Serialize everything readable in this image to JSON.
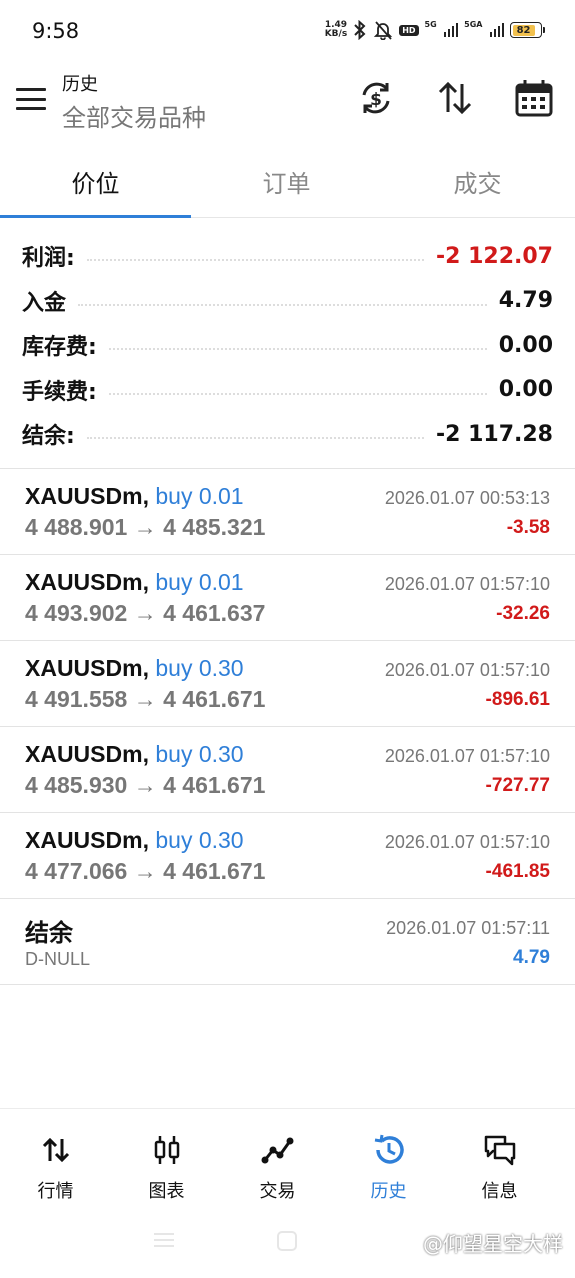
{
  "status_bar": {
    "time": "9:58",
    "net_speed_value": "1.49",
    "net_speed_unit": "KB/s",
    "hd_label": "HD",
    "sim1_label": "5G",
    "sim2_label": "5GA",
    "battery": "82",
    "battery_color": "#f2c14e"
  },
  "header": {
    "title": "历史",
    "subtitle": "全部交易品种",
    "icons": [
      "menu-icon",
      "currency-exchange-icon",
      "sort-icon",
      "calendar-icon"
    ]
  },
  "tabs": [
    {
      "label": "价位",
      "active": true
    },
    {
      "label": "订单",
      "active": false
    },
    {
      "label": "成交",
      "active": false
    }
  ],
  "summary": [
    {
      "label": "利润:",
      "value": "-2 122.07",
      "negative": true
    },
    {
      "label": "入金",
      "value": "4.79",
      "negative": false
    },
    {
      "label": "库存费:",
      "value": "0.00",
      "negative": false
    },
    {
      "label": "手续费:",
      "value": "0.00",
      "negative": false
    },
    {
      "label": "结余:",
      "value": "-2 117.28",
      "negative": false
    }
  ],
  "deals": [
    {
      "symbol": "XAUUSDm,",
      "side": "buy 0.01",
      "prices": "4 488.901 → 4 485.321",
      "datetime": "2026.01.07 00:53:13",
      "profit": "-3.58"
    },
    {
      "symbol": "XAUUSDm,",
      "side": "buy 0.01",
      "prices": "4 493.902 → 4 461.637",
      "datetime": "2026.01.07 01:57:10",
      "profit": "-32.26"
    },
    {
      "symbol": "XAUUSDm,",
      "side": "buy 0.30",
      "prices": "4 491.558 → 4 461.671",
      "datetime": "2026.01.07 01:57:10",
      "profit": "-896.61"
    },
    {
      "symbol": "XAUUSDm,",
      "side": "buy 0.30",
      "prices": "4 485.930 → 4 461.671",
      "datetime": "2026.01.07 01:57:10",
      "profit": "-727.77"
    },
    {
      "symbol": "XAUUSDm,",
      "side": "buy 0.30",
      "prices": "4 477.066 → 4 461.671",
      "datetime": "2026.01.07 01:57:10",
      "profit": "-461.85"
    }
  ],
  "balance_entry": {
    "title": "结余",
    "comment": "D-NULL",
    "datetime": "2026.01.07 01:57:11",
    "amount": "4.79"
  },
  "bottom_nav": [
    {
      "label": "行情",
      "icon": "quotes-arrows-icon",
      "active": false
    },
    {
      "label": "图表",
      "icon": "candlestick-chart-icon",
      "active": false
    },
    {
      "label": "交易",
      "icon": "trade-line-icon",
      "active": false
    },
    {
      "label": "历史",
      "icon": "history-clock-icon",
      "active": true
    },
    {
      "label": "信息",
      "icon": "messages-icon",
      "active": false
    }
  ],
  "colors": {
    "accent": "#2f7fd8",
    "negative": "#d11a1a",
    "muted": "#777777"
  },
  "watermark": "@仰望星空大样"
}
